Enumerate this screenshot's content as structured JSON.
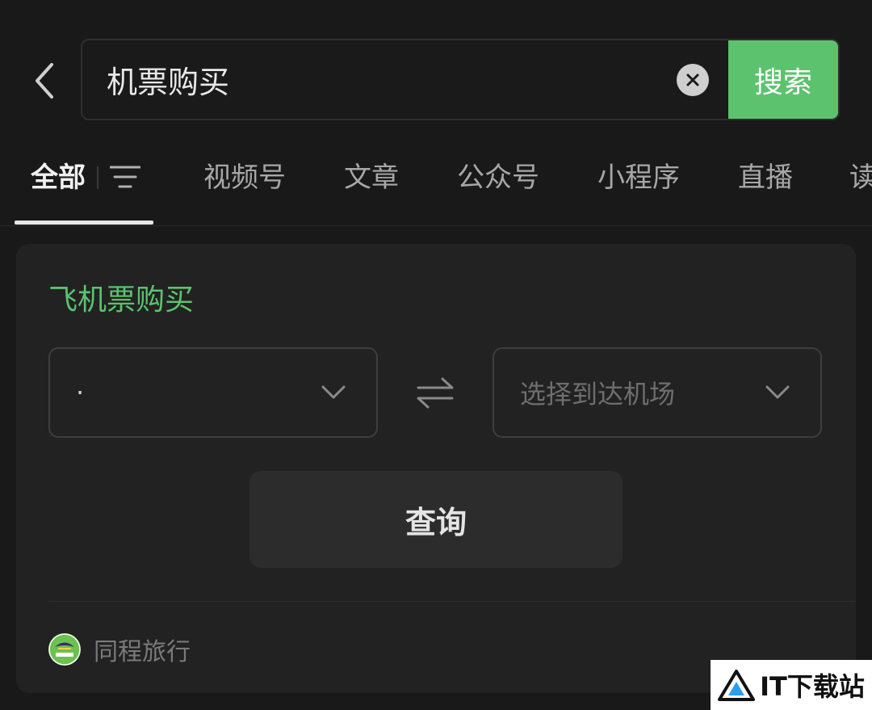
{
  "search": {
    "value": "机票购买",
    "button_label": "搜索"
  },
  "tabs": [
    {
      "label": "全部",
      "active": true
    },
    {
      "label": "视频号"
    },
    {
      "label": "文章"
    },
    {
      "label": "公众号"
    },
    {
      "label": "小程序"
    },
    {
      "label": "直播"
    },
    {
      "label": "读"
    }
  ],
  "card": {
    "title": "飞机票购买",
    "from_value": "·",
    "to_placeholder": "选择到达机场",
    "query_label": "查询",
    "provider_name": "同程旅行"
  },
  "watermark": {
    "text": "IT下载站"
  },
  "colors": {
    "accent": "#5cc26e",
    "background": "#191919",
    "card": "#222222"
  }
}
